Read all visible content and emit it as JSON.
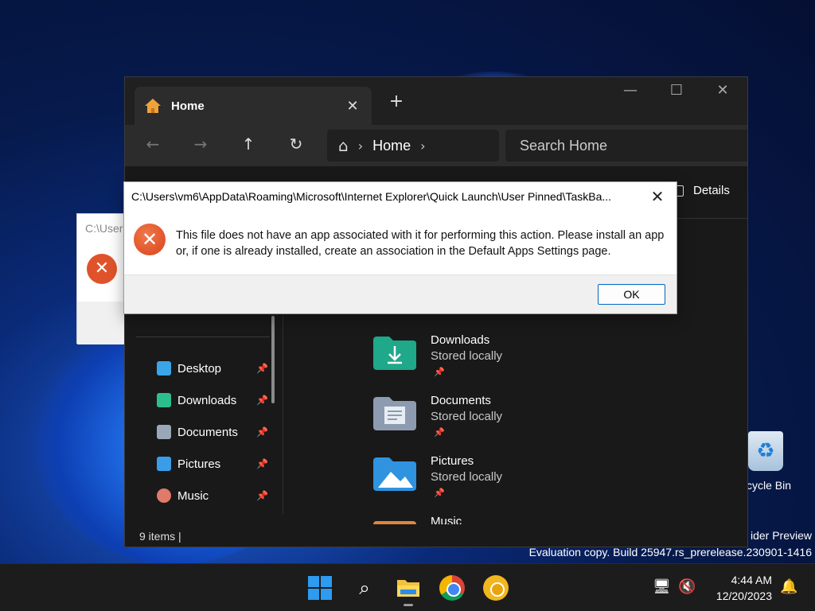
{
  "desktop": {
    "recycle_bin_label": "cycle Bin",
    "watermark_line1": "ider Preview",
    "watermark_line2": "Evaluation copy. Build 25947.rs_prerelease.230901-1416"
  },
  "explorer": {
    "tab_label": "Home",
    "tab_close": "✕",
    "new_tab": "+",
    "window_controls": {
      "minimize": "—",
      "maximize": "☐",
      "close": "✕"
    },
    "nav": {
      "back": "←",
      "forward": "→",
      "up": "↑",
      "refresh": "↻"
    },
    "address": {
      "home_icon": "⌂",
      "sep1": "›",
      "crumb": "Home",
      "sep2": "›"
    },
    "search_placeholder": "Search Home",
    "details_label": "Details",
    "sidebar": [
      {
        "label": "Desktop",
        "color": "#3aa6e8",
        "pin": "📌"
      },
      {
        "label": "Downloads",
        "color": "#2bbf8f",
        "pin": "📌"
      },
      {
        "label": "Documents",
        "color": "#9aa7b8",
        "pin": "📌"
      },
      {
        "label": "Pictures",
        "color": "#3a9de8",
        "pin": "📌"
      },
      {
        "label": "Music",
        "color": "#e07a6a",
        "pin": "📌"
      }
    ],
    "folders": [
      {
        "name": "Downloads",
        "sub": "Stored locally",
        "pin": "📌",
        "color": "#1fa88a"
      },
      {
        "name": "Documents",
        "sub": "Stored locally",
        "pin": "📌",
        "color": "#8d9bb0"
      },
      {
        "name": "Pictures",
        "sub": "Stored locally",
        "pin": "📌",
        "color": "#2f93e0"
      },
      {
        "name": "Music",
        "sub": "",
        "pin": "",
        "color": "#e0873a"
      }
    ],
    "status": "9 items   |"
  },
  "bg_dialog": {
    "title": "C:\\Users",
    "icon": "✕"
  },
  "dialog": {
    "title": "C:\\Users\\vm6\\AppData\\Roaming\\Microsoft\\Internet Explorer\\Quick Launch\\User Pinned\\TaskBa...",
    "close": "✕",
    "icon": "✕",
    "message": "This file does not have an app associated with it for performing this action. Please install an app or, if one is already installed, create an association in the Default Apps Settings page.",
    "ok_label": "OK"
  },
  "taskbar": {
    "search_icon": "⌕",
    "time": "4:44 AM",
    "date": "12/20/2023",
    "network_icon": "🖥",
    "volume_icon": "🔇",
    "bell_icon": "🔔"
  }
}
